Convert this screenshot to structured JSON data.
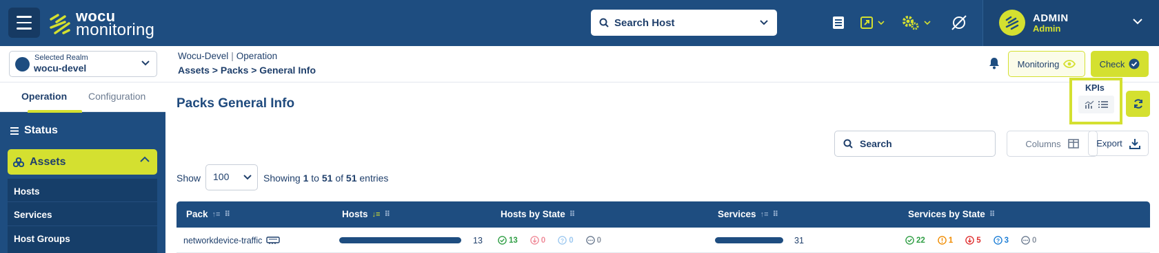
{
  "app": {
    "logo_line1": "wocu",
    "logo_line2": "monitoring",
    "brand_colors": {
      "navy": "#1e4d80",
      "lime": "#d4e030"
    }
  },
  "header": {
    "host_search_placeholder": "Search Host",
    "user": {
      "name": "ADMIN",
      "role": "Admin"
    },
    "icons": [
      "book-icon",
      "external-link-icon",
      "gears-icon",
      "no-signal-icon"
    ]
  },
  "realm": {
    "label": "Selected Realm",
    "value": "wocu-devel"
  },
  "breadcrumb": {
    "realm": "Wocu-Devel",
    "sep": "|",
    "section": "Operation",
    "path": "Assets > Packs > General Info"
  },
  "actions": {
    "monitoring": "Monitoring",
    "check": "Check"
  },
  "sidebar": {
    "tabs": [
      "Operation",
      "Configuration"
    ],
    "status": "Status",
    "assets": "Assets",
    "sub_items": [
      "Hosts",
      "Services",
      "Host Groups"
    ]
  },
  "page": {
    "title": "Packs General Info",
    "kpis": "KPIs",
    "search_placeholder": "Search",
    "columns_btn": "Columns",
    "export_btn": "Export"
  },
  "pagination": {
    "show_label": "Show",
    "page_size": "100",
    "showing_prefix": "Showing",
    "from": "1",
    "to_word": "to",
    "to": "51",
    "of_word": "of",
    "total": "51",
    "suffix": "entries"
  },
  "table": {
    "headers": [
      "Pack",
      "Hosts",
      "Hosts by State",
      "Services",
      "Services by State"
    ],
    "rows": [
      {
        "pack": "networkdevice-traffic",
        "hosts": "13",
        "hosts_fill": 1.0,
        "hosts_state": {
          "up": "13",
          "down": "0",
          "unknown": "0",
          "pending": "0"
        },
        "services": "31",
        "services_fill": 1.0,
        "services_state": {
          "ok": "22",
          "warning": "1",
          "critical": "5",
          "unknown": "3",
          "pending": "0"
        }
      }
    ]
  }
}
